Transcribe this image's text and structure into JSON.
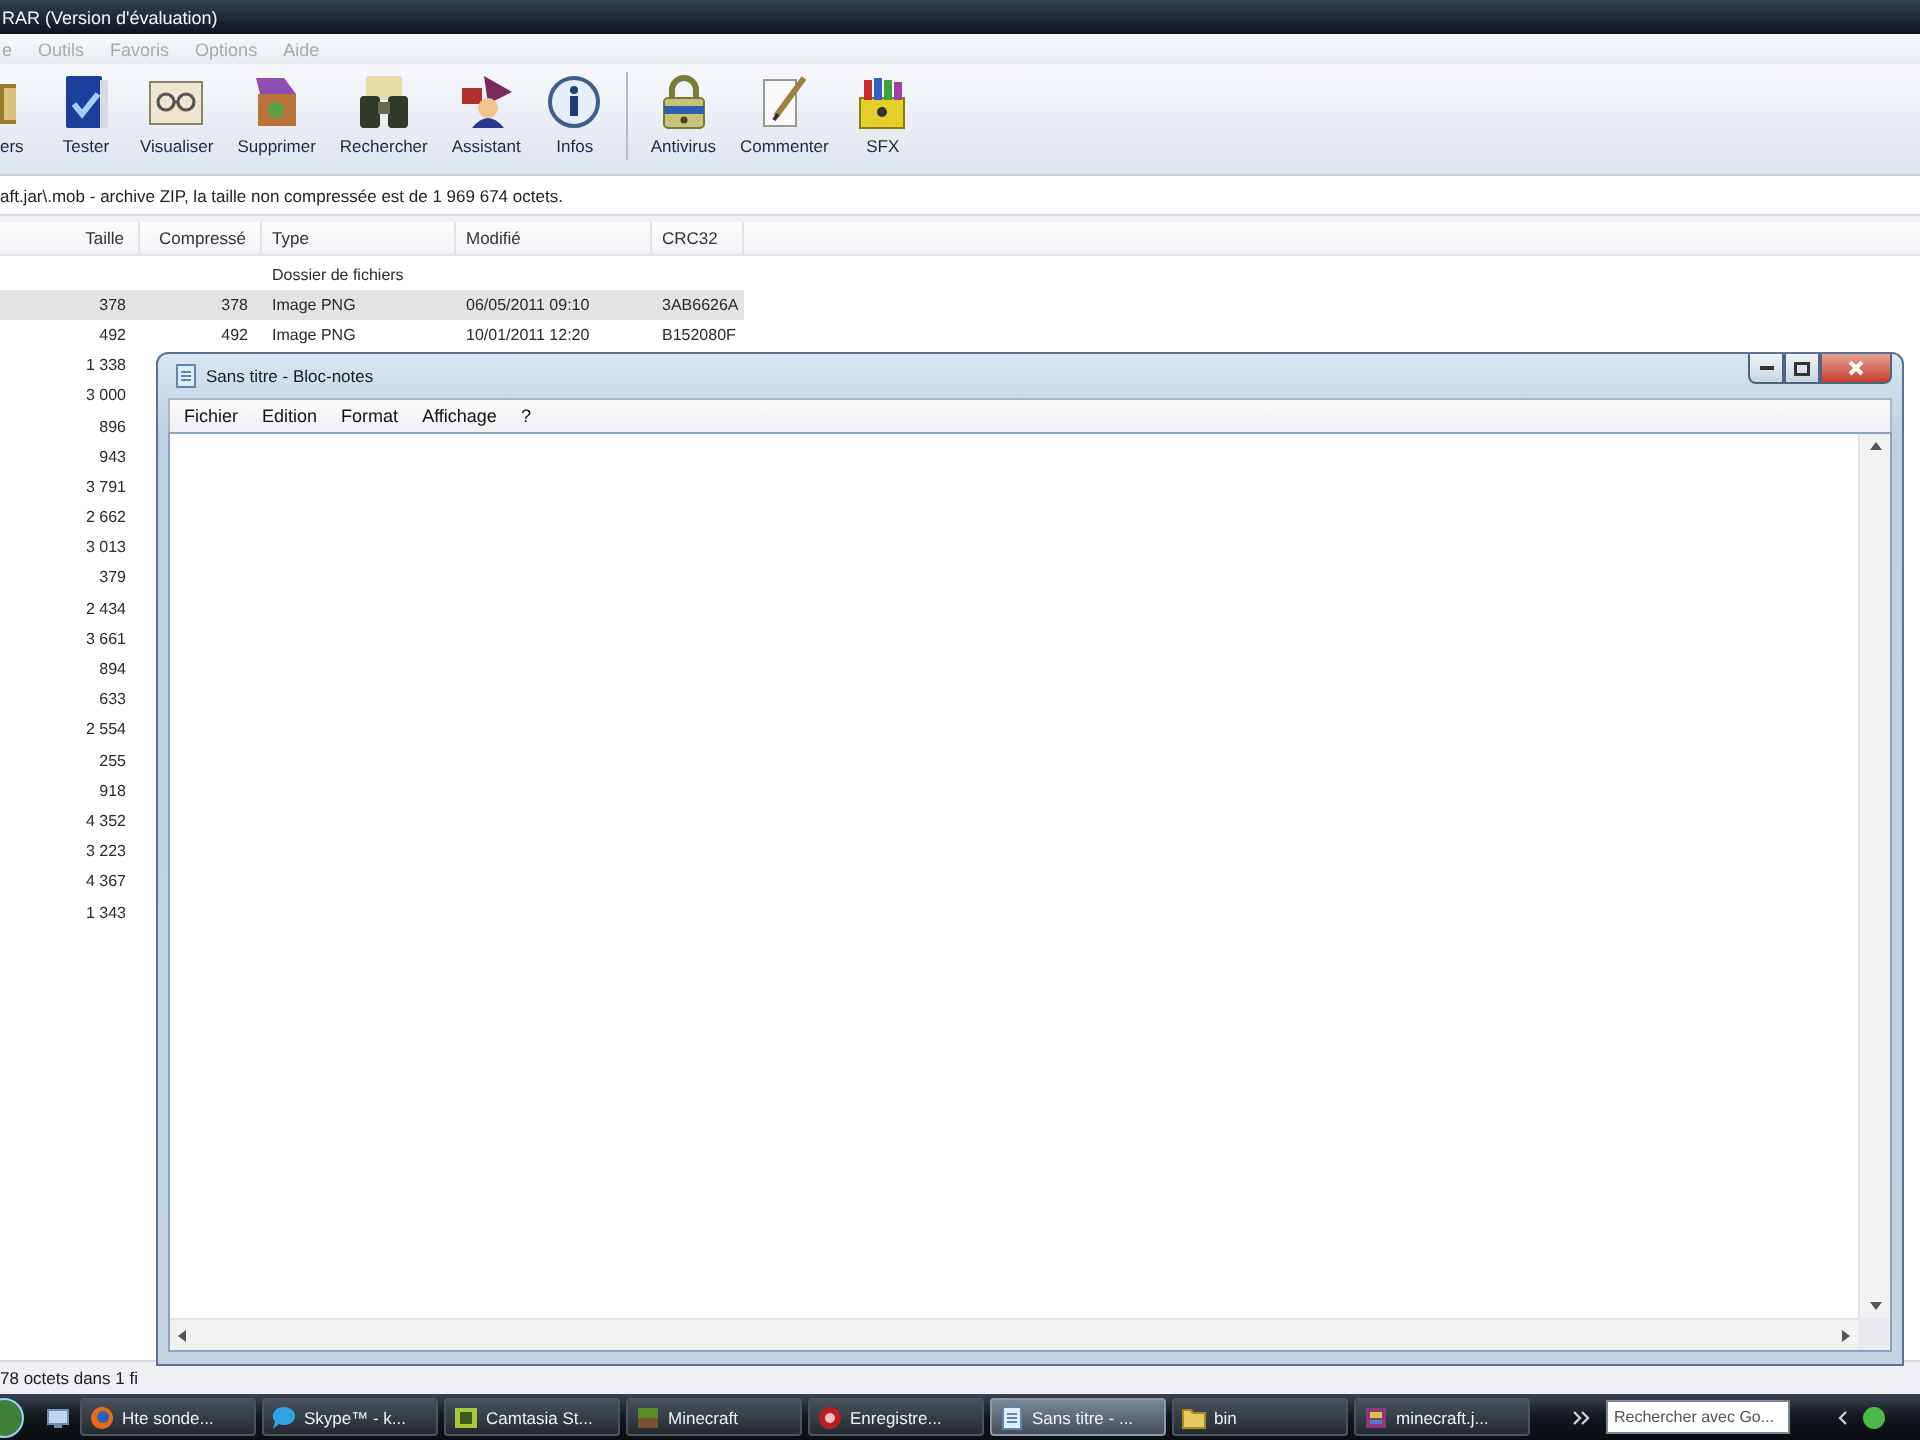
{
  "window": {
    "title": "RAR (Version d'évaluation)"
  },
  "menu": [
    "e",
    "Outils",
    "Favoris",
    "Options",
    "Aide"
  ],
  "toolbar_groups": [
    [
      {
        "label": "ers",
        "kind": "extract"
      },
      {
        "label": "Tester",
        "kind": "test"
      },
      {
        "label": "Visualiser",
        "kind": "view"
      },
      {
        "label": "Supprimer",
        "kind": "delete"
      },
      {
        "label": "Rechercher",
        "kind": "find"
      },
      {
        "label": "Assistant",
        "kind": "wizard"
      },
      {
        "label": "Infos",
        "kind": "info"
      }
    ],
    [
      {
        "label": "Antivirus",
        "kind": "antivirus"
      },
      {
        "label": "Commenter",
        "kind": "comment"
      },
      {
        "label": "SFX",
        "kind": "sfx"
      }
    ]
  ],
  "path_bar": {
    "text": "aft.jar\\.mob - archive ZIP, la taille non compressée est de 1 969 674 octets."
  },
  "file_list": {
    "columns": [
      "Taille",
      "Compressé",
      "Type",
      "Modifié",
      "CRC32"
    ],
    "rows": [
      {
        "type": "Dossier de fichiers",
        "selected": false
      },
      {
        "size": "378",
        "packed": "378",
        "type": "Image PNG",
        "modified": "06/05/2011 09:10",
        "crc": "3AB6626A",
        "selected": true
      },
      {
        "size": "492",
        "packed": "492",
        "type": "Image PNG",
        "modified": "10/01/2011 12:20",
        "crc": "B152080F",
        "selected": false
      },
      {
        "size": "1 338",
        "selected": false
      },
      {
        "size": "3 000",
        "selected": false
      },
      {
        "size": "896",
        "selected": false
      },
      {
        "size": "943",
        "selected": false
      },
      {
        "size": "3 791",
        "selected": false
      },
      {
        "size": "2 662",
        "selected": false
      },
      {
        "size": "3 013",
        "selected": false
      },
      {
        "size": "379",
        "selected": false
      },
      {
        "size": "2 434",
        "selected": false
      },
      {
        "size": "3 661",
        "selected": false
      },
      {
        "size": "894",
        "selected": false
      },
      {
        "size": "633",
        "selected": false
      },
      {
        "size": "2 554",
        "selected": false
      },
      {
        "size": "255",
        "selected": false
      },
      {
        "size": "918",
        "selected": false
      },
      {
        "size": "4 352",
        "selected": false
      },
      {
        "size": "3 223",
        "selected": false
      },
      {
        "size": "4 367",
        "selected": false
      },
      {
        "size": "1 343",
        "selected": false
      }
    ]
  },
  "status_bar": {
    "left": "78 octets dans 1 fi"
  },
  "notepad": {
    "title": "Sans titre - Bloc-notes",
    "menu": [
      "Fichier",
      "Edition",
      "Format",
      "Affichage",
      "?"
    ]
  },
  "taskbar": {
    "tasks": [
      {
        "label": "Hte sonde...",
        "kind": "browser",
        "selected": false
      },
      {
        "label": "Skype™ - k...",
        "kind": "chat",
        "selected": false
      },
      {
        "label": "Camtasia St...",
        "kind": "recorder",
        "selected": false
      },
      {
        "label": "Minecraft",
        "kind": "game",
        "selected": false
      },
      {
        "label": "Enregistre...",
        "kind": "record",
        "selected": false
      },
      {
        "label": "Sans titre - ...",
        "kind": "notepad",
        "selected": true
      },
      {
        "label": "bin",
        "kind": "folder",
        "selected": false
      },
      {
        "label": "minecraft.j...",
        "kind": "archive",
        "selected": false
      }
    ],
    "search": {
      "placeholder": "Rechercher avec Go..."
    }
  }
}
